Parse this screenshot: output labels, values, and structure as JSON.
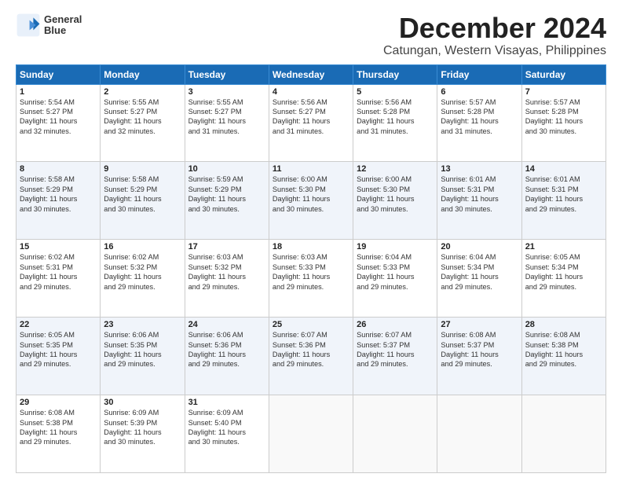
{
  "header": {
    "logo_line1": "General",
    "logo_line2": "Blue",
    "main_title": "December 2024",
    "sub_title": "Catungan, Western Visayas, Philippines"
  },
  "columns": [
    "Sunday",
    "Monday",
    "Tuesday",
    "Wednesday",
    "Thursday",
    "Friday",
    "Saturday"
  ],
  "weeks": [
    [
      {
        "day": "1",
        "info": "Sunrise: 5:54 AM\nSunset: 5:27 PM\nDaylight: 11 hours\nand 32 minutes."
      },
      {
        "day": "2",
        "info": "Sunrise: 5:55 AM\nSunset: 5:27 PM\nDaylight: 11 hours\nand 32 minutes."
      },
      {
        "day": "3",
        "info": "Sunrise: 5:55 AM\nSunset: 5:27 PM\nDaylight: 11 hours\nand 31 minutes."
      },
      {
        "day": "4",
        "info": "Sunrise: 5:56 AM\nSunset: 5:27 PM\nDaylight: 11 hours\nand 31 minutes."
      },
      {
        "day": "5",
        "info": "Sunrise: 5:56 AM\nSunset: 5:28 PM\nDaylight: 11 hours\nand 31 minutes."
      },
      {
        "day": "6",
        "info": "Sunrise: 5:57 AM\nSunset: 5:28 PM\nDaylight: 11 hours\nand 31 minutes."
      },
      {
        "day": "7",
        "info": "Sunrise: 5:57 AM\nSunset: 5:28 PM\nDaylight: 11 hours\nand 30 minutes."
      }
    ],
    [
      {
        "day": "8",
        "info": "Sunrise: 5:58 AM\nSunset: 5:29 PM\nDaylight: 11 hours\nand 30 minutes."
      },
      {
        "day": "9",
        "info": "Sunrise: 5:58 AM\nSunset: 5:29 PM\nDaylight: 11 hours\nand 30 minutes."
      },
      {
        "day": "10",
        "info": "Sunrise: 5:59 AM\nSunset: 5:29 PM\nDaylight: 11 hours\nand 30 minutes."
      },
      {
        "day": "11",
        "info": "Sunrise: 6:00 AM\nSunset: 5:30 PM\nDaylight: 11 hours\nand 30 minutes."
      },
      {
        "day": "12",
        "info": "Sunrise: 6:00 AM\nSunset: 5:30 PM\nDaylight: 11 hours\nand 30 minutes."
      },
      {
        "day": "13",
        "info": "Sunrise: 6:01 AM\nSunset: 5:31 PM\nDaylight: 11 hours\nand 30 minutes."
      },
      {
        "day": "14",
        "info": "Sunrise: 6:01 AM\nSunset: 5:31 PM\nDaylight: 11 hours\nand 29 minutes."
      }
    ],
    [
      {
        "day": "15",
        "info": "Sunrise: 6:02 AM\nSunset: 5:31 PM\nDaylight: 11 hours\nand 29 minutes."
      },
      {
        "day": "16",
        "info": "Sunrise: 6:02 AM\nSunset: 5:32 PM\nDaylight: 11 hours\nand 29 minutes."
      },
      {
        "day": "17",
        "info": "Sunrise: 6:03 AM\nSunset: 5:32 PM\nDaylight: 11 hours\nand 29 minutes."
      },
      {
        "day": "18",
        "info": "Sunrise: 6:03 AM\nSunset: 5:33 PM\nDaylight: 11 hours\nand 29 minutes."
      },
      {
        "day": "19",
        "info": "Sunrise: 6:04 AM\nSunset: 5:33 PM\nDaylight: 11 hours\nand 29 minutes."
      },
      {
        "day": "20",
        "info": "Sunrise: 6:04 AM\nSunset: 5:34 PM\nDaylight: 11 hours\nand 29 minutes."
      },
      {
        "day": "21",
        "info": "Sunrise: 6:05 AM\nSunset: 5:34 PM\nDaylight: 11 hours\nand 29 minutes."
      }
    ],
    [
      {
        "day": "22",
        "info": "Sunrise: 6:05 AM\nSunset: 5:35 PM\nDaylight: 11 hours\nand 29 minutes."
      },
      {
        "day": "23",
        "info": "Sunrise: 6:06 AM\nSunset: 5:35 PM\nDaylight: 11 hours\nand 29 minutes."
      },
      {
        "day": "24",
        "info": "Sunrise: 6:06 AM\nSunset: 5:36 PM\nDaylight: 11 hours\nand 29 minutes."
      },
      {
        "day": "25",
        "info": "Sunrise: 6:07 AM\nSunset: 5:36 PM\nDaylight: 11 hours\nand 29 minutes."
      },
      {
        "day": "26",
        "info": "Sunrise: 6:07 AM\nSunset: 5:37 PM\nDaylight: 11 hours\nand 29 minutes."
      },
      {
        "day": "27",
        "info": "Sunrise: 6:08 AM\nSunset: 5:37 PM\nDaylight: 11 hours\nand 29 minutes."
      },
      {
        "day": "28",
        "info": "Sunrise: 6:08 AM\nSunset: 5:38 PM\nDaylight: 11 hours\nand 29 minutes."
      }
    ],
    [
      {
        "day": "29",
        "info": "Sunrise: 6:08 AM\nSunset: 5:38 PM\nDaylight: 11 hours\nand 29 minutes."
      },
      {
        "day": "30",
        "info": "Sunrise: 6:09 AM\nSunset: 5:39 PM\nDaylight: 11 hours\nand 30 minutes."
      },
      {
        "day": "31",
        "info": "Sunrise: 6:09 AM\nSunset: 5:40 PM\nDaylight: 11 hours\nand 30 minutes."
      },
      {
        "day": "",
        "info": ""
      },
      {
        "day": "",
        "info": ""
      },
      {
        "day": "",
        "info": ""
      },
      {
        "day": "",
        "info": ""
      }
    ]
  ]
}
